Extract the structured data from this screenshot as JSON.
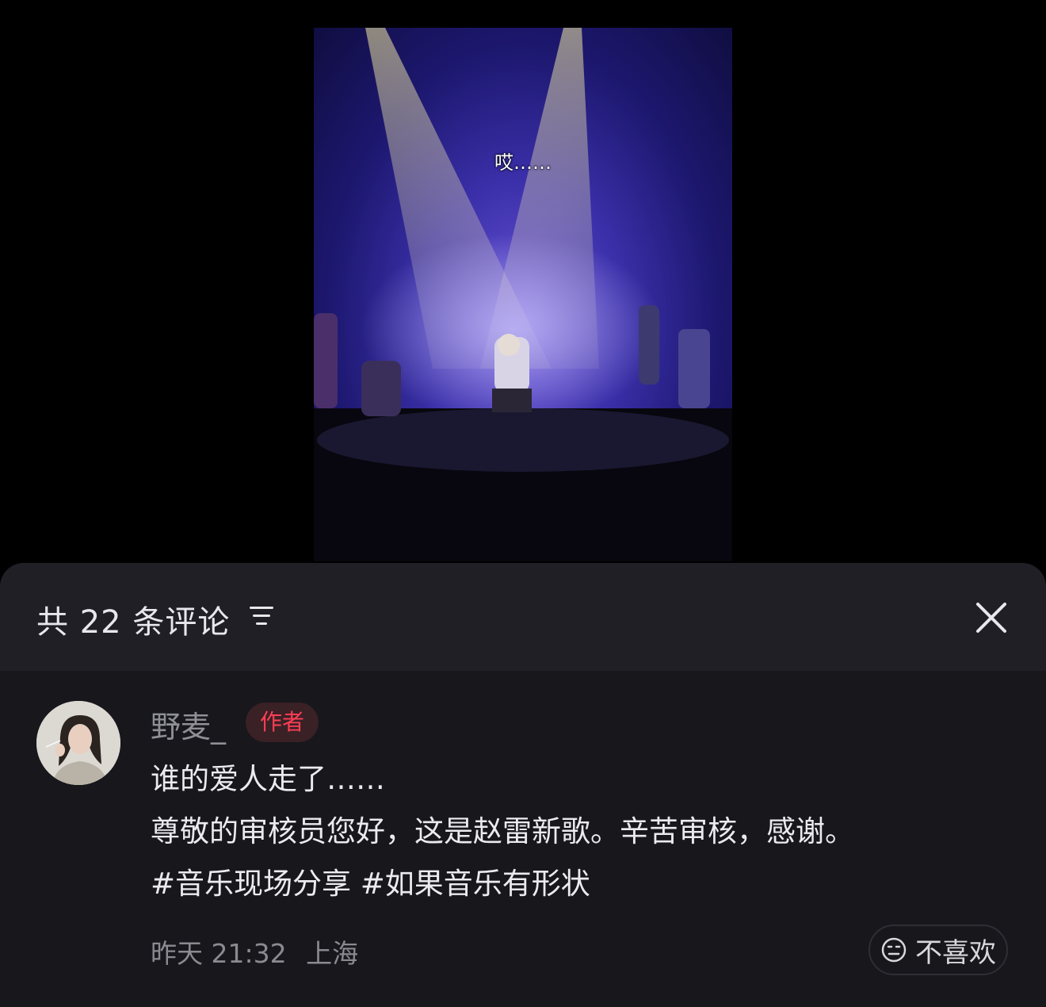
{
  "video": {
    "subtitle": "哎……"
  },
  "comments_panel": {
    "title": "共 22 条评论",
    "sort_icon": "sort-lines-icon",
    "close_icon": "close-x-icon"
  },
  "comment": {
    "username": "野麦_",
    "badge": "作者",
    "lines": [
      "谁的爱人走了……",
      "尊敬的审核员您好，这是赵雷新歌。辛苦审核，感谢。",
      "#音乐现场分享 #如果音乐有形状"
    ],
    "time": "昨天 21:32",
    "location": "上海",
    "dislike_label": "不喜欢",
    "dislike_icon": "neutral-face-icon"
  },
  "colors": {
    "panel_bg": "#17171c",
    "header_bg": "#1f1f25",
    "badge_text": "#ff3e55",
    "badge_bg": "#3a2125"
  }
}
